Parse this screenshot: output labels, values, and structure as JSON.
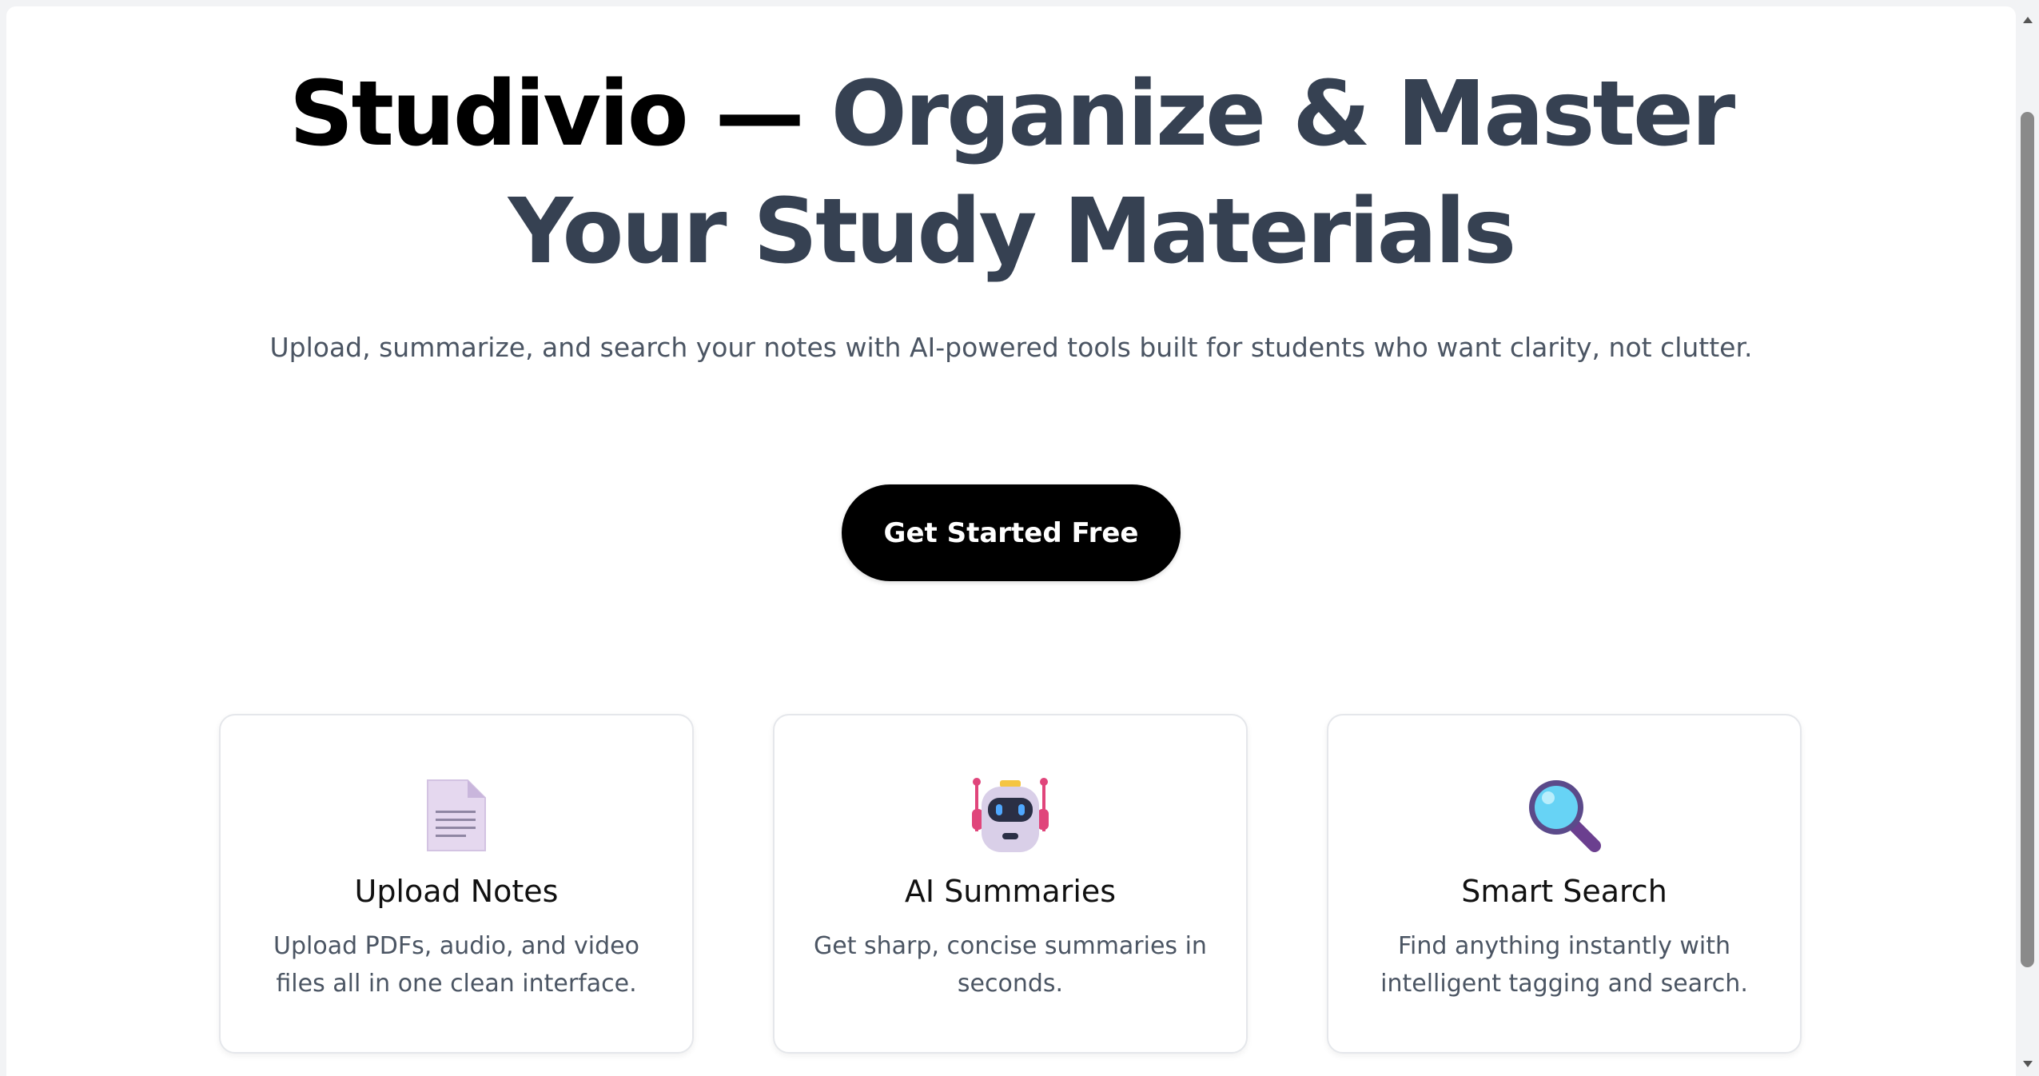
{
  "hero": {
    "title_brand": "Studivio —",
    "title_rest_line1": "Organize & Master",
    "title_line2": "Your Study Materials",
    "subtitle": "Upload, summarize, and search your notes with AI-powered tools built for students who want clarity, not clutter.",
    "cta_label": "Get Started Free"
  },
  "features": [
    {
      "icon": "document-icon",
      "title": "Upload Notes",
      "description": "Upload PDFs, audio, and video files all in one clean interface."
    },
    {
      "icon": "robot-icon",
      "title": "AI Summaries",
      "description": "Get sharp, concise summaries in seconds."
    },
    {
      "icon": "magnifier-icon",
      "title": "Smart Search",
      "description": "Find anything instantly with intelligent tagging and search."
    }
  ],
  "colors": {
    "title_dark": "#364152",
    "brand": "#000000",
    "body_text": "#4b5563",
    "cta_bg": "#000000",
    "card_border": "#e5e7eb"
  }
}
